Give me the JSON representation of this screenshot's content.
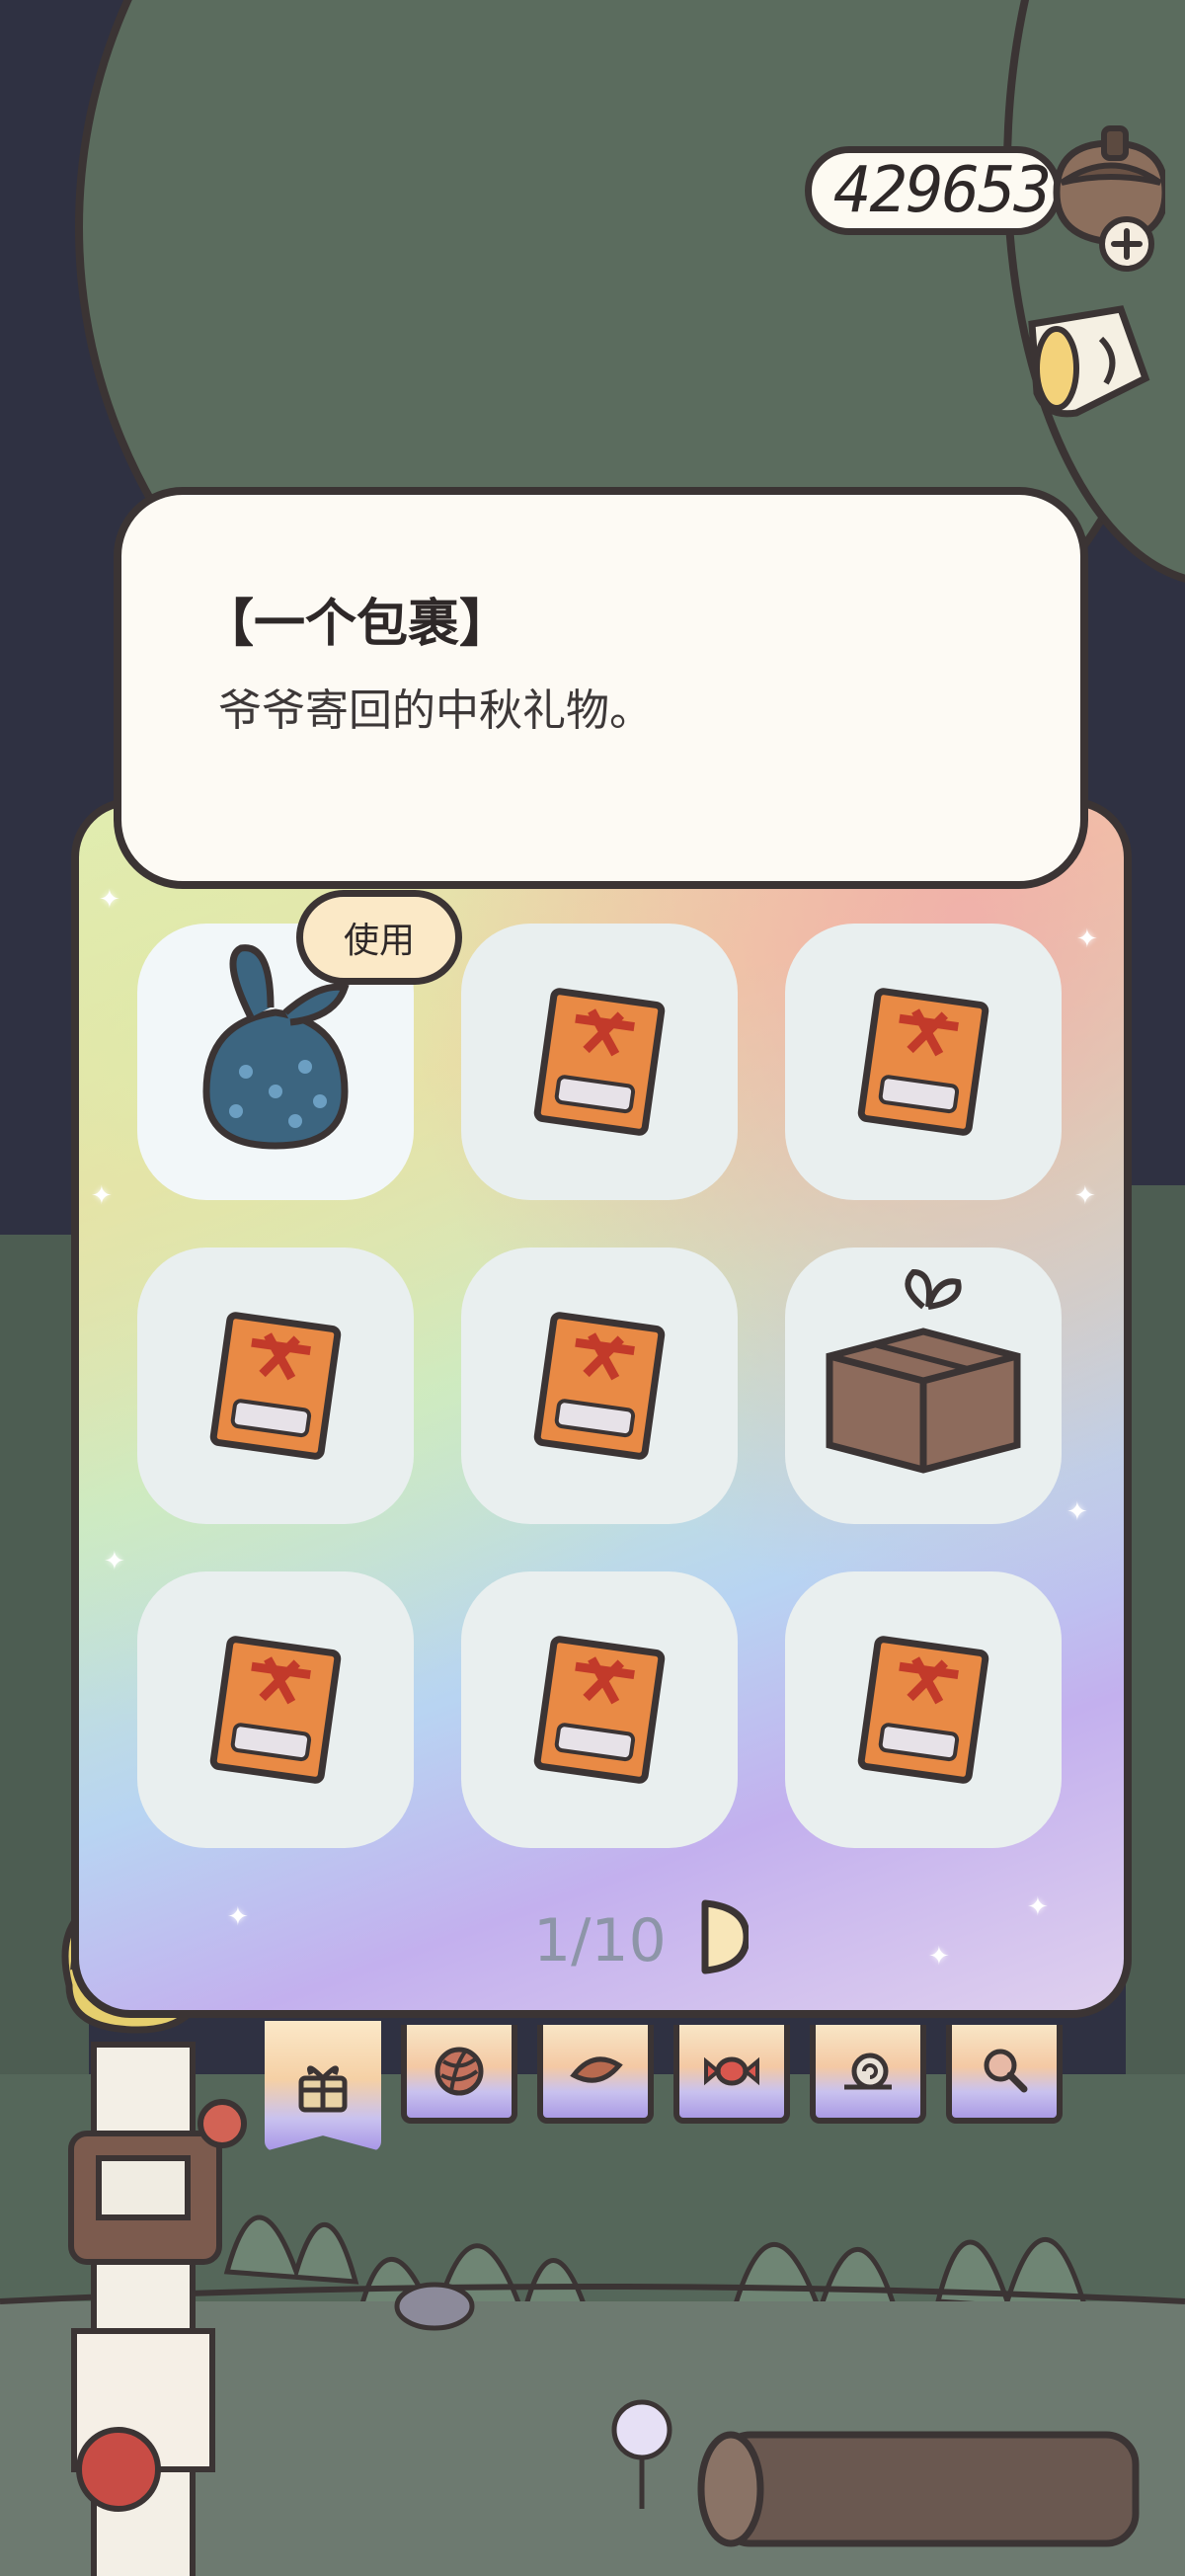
{
  "currency": {
    "amount": "429653",
    "coin_icon": "acorn-coin-icon",
    "add_icon": "plus-icon"
  },
  "item": {
    "title": "【一个包裹】",
    "description": "爷爷寄回的中秋礼物。"
  },
  "actions": {
    "use_label": "使用"
  },
  "inventory": {
    "slots": [
      {
        "icon": "cloth-bundle-icon",
        "selected": true
      },
      {
        "icon": "lottery-ticket-icon"
      },
      {
        "icon": "lottery-ticket-icon"
      },
      {
        "icon": "lottery-ticket-icon"
      },
      {
        "icon": "lottery-ticket-icon"
      },
      {
        "icon": "cardboard-box-icon"
      },
      {
        "icon": "lottery-ticket-icon"
      },
      {
        "icon": "lottery-ticket-icon"
      },
      {
        "icon": "lottery-ticket-icon"
      }
    ],
    "page": "1/10"
  },
  "tabs": [
    {
      "icon": "gift-icon",
      "active": true
    },
    {
      "icon": "yarn-ball-icon"
    },
    {
      "icon": "leaf-icon"
    },
    {
      "icon": "candy-icon"
    },
    {
      "icon": "snail-icon"
    },
    {
      "icon": "magnifier-icon"
    }
  ],
  "colors": {
    "outline": "#3b3434",
    "card": "#fdfaf4",
    "slot": "#e9efef",
    "foliage": "#5a6b5d"
  }
}
